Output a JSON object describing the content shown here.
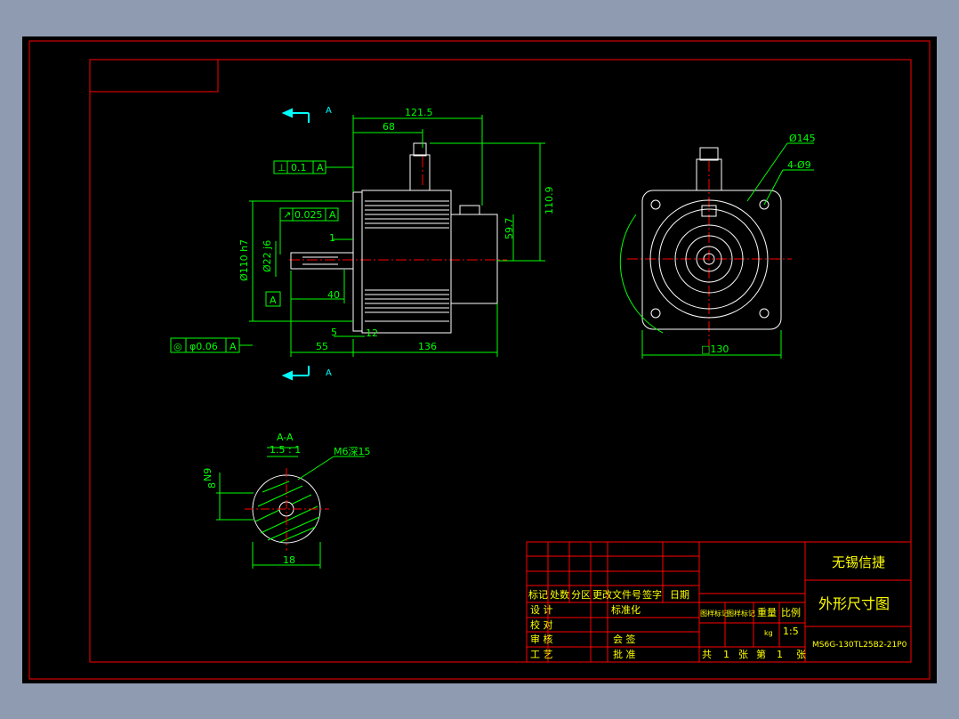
{
  "colors": {
    "background": "#8e9bb0",
    "sheet": "#000000",
    "frame": "#ff0000",
    "geometry": "#ffffff",
    "dimension": "#00ff00",
    "centerline": "#ff0000",
    "hatch": "#00ff00",
    "title_text": "#ffff00",
    "section_arrow": "#00ffff"
  },
  "front_view": {
    "section_marks": [
      "A",
      "A"
    ],
    "dims": {
      "overall_top": "121.5",
      "connector_offset": "68",
      "height_right": "110.9",
      "height_inner": "59.7",
      "flange_pilot": "Ø110 h7",
      "shaft_dia": "Ø22 j6",
      "shaft_len": "40",
      "flange_front": "55",
      "body_len": "136",
      "flange_thk": "5",
      "flange_gap": "12",
      "step": "1"
    },
    "tolerance_frames": [
      {
        "symbol": "⊥",
        "value": "0.1",
        "datum": "A"
      },
      {
        "symbol": "↗",
        "value": "0.025",
        "datum": "A"
      },
      {
        "symbol": "◎",
        "value": "φ0.06",
        "datum": "A"
      }
    ],
    "datum_label": "A"
  },
  "side_view": {
    "pcd": "Ø145",
    "holes": "4-Ø9",
    "square": "□130"
  },
  "section_view": {
    "title": "A-A",
    "scale": "1.5 : 1",
    "thread": "M6深15",
    "key_width": "N9",
    "key_depth": "8",
    "diameter": "18"
  },
  "title_block": {
    "company": "无锡信捷",
    "drawing_title": "外形尺寸图",
    "drawing_no": "MS6G-130TL25B2-21P0",
    "revision_header": [
      "标记",
      "处数",
      "分区",
      "更改文件号",
      "签字",
      "日期"
    ],
    "roles": [
      "设 计",
      "校 对",
      "审 核",
      "工 艺"
    ],
    "roles_right": [
      "标准化",
      "会 签",
      "批 准"
    ],
    "stage_label": "图样标记",
    "weight_label": "重量",
    "scale_label": "比例",
    "scale_value": "1:5",
    "weight_unit": "kg",
    "sheet_total_prefix": "共",
    "sheet_total": "1",
    "sheet_unit": "张",
    "sheet_no_prefix": "第",
    "sheet_no": "1",
    "sheet_no_unit": "张"
  }
}
